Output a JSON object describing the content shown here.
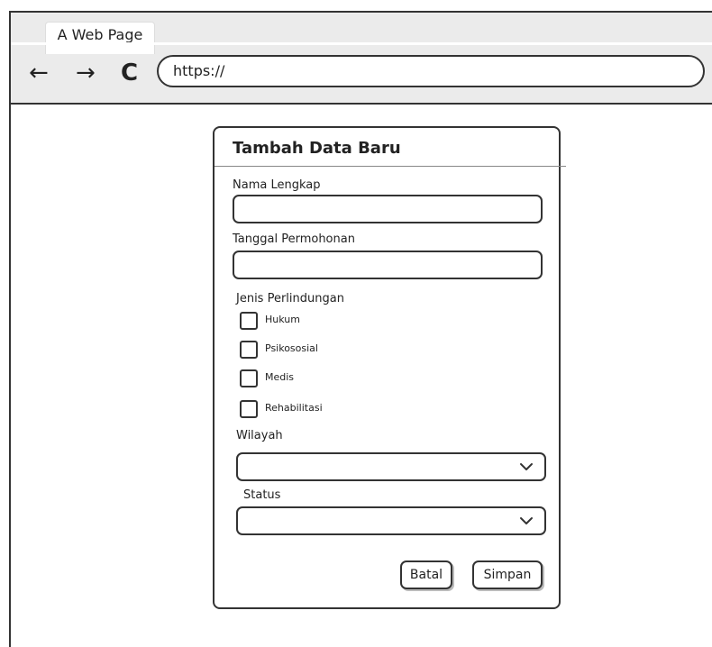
{
  "browser": {
    "tab_title": "A Web Page",
    "url": "https://",
    "back_icon": "←",
    "forward_icon": "→",
    "reload_icon": "C"
  },
  "dialog": {
    "title": "Tambah Data Baru",
    "fields": {
      "nama_lengkap_label": "Nama Lengkap",
      "nama_lengkap_value": "",
      "tanggal_label": "Tanggal Permohonan",
      "tanggal_value": "",
      "jenis_label": "Jenis Perlindungan",
      "jenis_options": [
        "Hukum",
        "Psikososial",
        "Medis",
        "Rehabilitasi"
      ],
      "jenis_checked": [
        false,
        false,
        false,
        false
      ],
      "wilayah_label": "Wilayah",
      "wilayah_value": "",
      "status_label": "Status",
      "status_value": ""
    },
    "buttons": {
      "cancel_label": "Batal",
      "save_label": "Simpan"
    }
  },
  "colors": {
    "border": "#333333",
    "chrome_background": "#ebebeb",
    "page_background": "#ffffff"
  }
}
